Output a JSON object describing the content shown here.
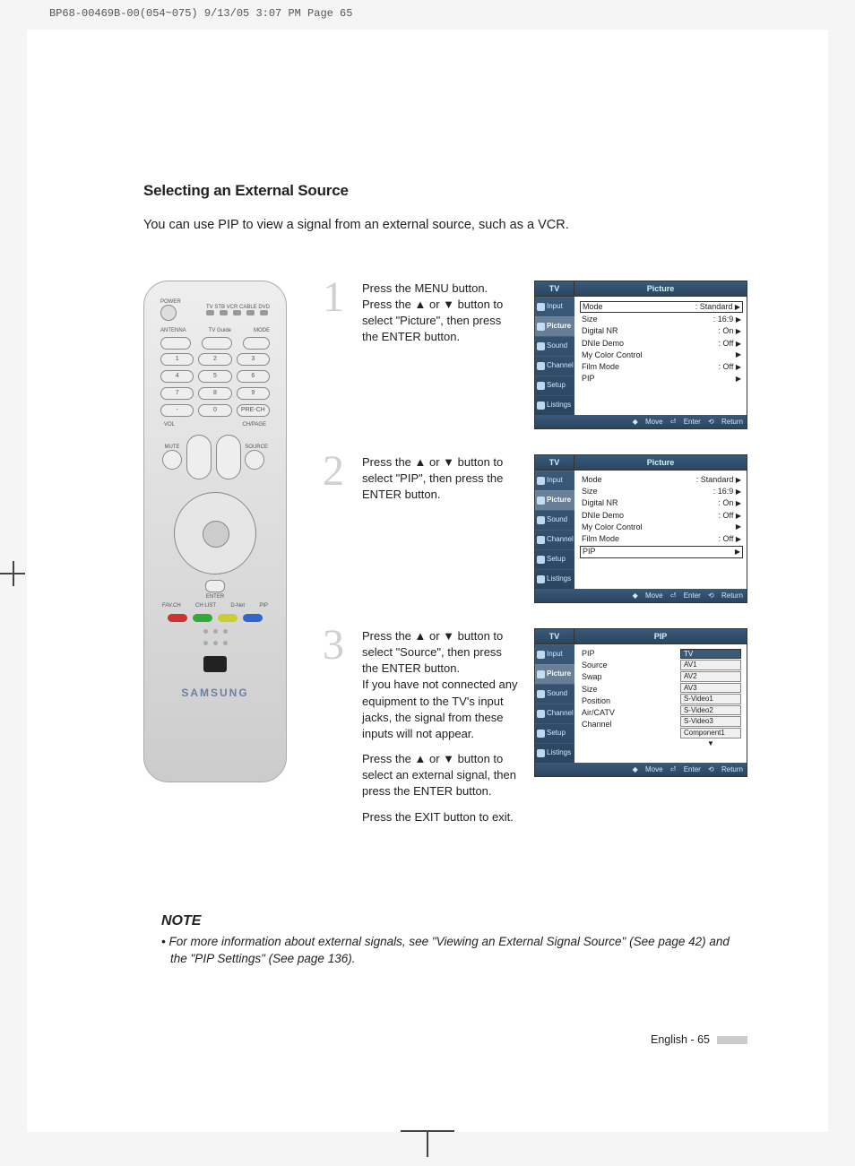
{
  "print_header": "BP68-00469B-00(054~075)  9/13/05  3:07 PM  Page 65",
  "title": "Selecting an External Source",
  "intro": "You can use PIP to view a signal from an external source, such as a VCR.",
  "remote": {
    "power": "POWER",
    "srclabels": "TV  STB  VCR  CABLE  DVD",
    "ant": "ANTENNA",
    "tvguide": "TV Guide",
    "mode": "MODE",
    "nums": [
      "1",
      "2",
      "3",
      "4",
      "5",
      "6",
      "7",
      "8",
      "9",
      "-",
      "0",
      "PRE-CH"
    ],
    "vol": "VOL",
    "mute": "MUTE",
    "chlabel": "CH/PAGE",
    "source": "SOURCE",
    "enter": "ENTER",
    "row4": [
      "FAV.CH",
      "CH LIST",
      "D-Net",
      "PIP"
    ],
    "brand": "SAMSUNG"
  },
  "steps": {
    "s1": {
      "num": "1",
      "text": "Press the MENU button.\nPress the ▲ or ▼ button to select \"Picture\", then press the ENTER button."
    },
    "s2": {
      "num": "2",
      "text": "Press the ▲ or ▼ button to select \"PIP\", then press the ENTER button."
    },
    "s3": {
      "num": "3",
      "textA": "Press the ▲ or ▼ button to select \"Source\", then press the ENTER button.\nIf you have not connected any equipment to the TV's input jacks, the signal from these inputs will not appear.",
      "textB": "Press the ▲ or ▼ button to select an external signal, then press the ENTER button.",
      "textC": "Press the EXIT button to exit."
    }
  },
  "osd": {
    "side": [
      "Input",
      "Picture",
      "Sound",
      "Channel",
      "Setup",
      "Listings"
    ],
    "footer": {
      "move": "Move",
      "enter": "Enter",
      "return": "Return"
    },
    "picture": {
      "title": "Picture",
      "tv": "TV",
      "rows": [
        {
          "k": "Mode",
          "v": ": Standard"
        },
        {
          "k": "Size",
          "v": ": 16:9"
        },
        {
          "k": "Digital NR",
          "v": ": On"
        },
        {
          "k": "DNIe Demo",
          "v": ": Off"
        },
        {
          "k": "My Color Control",
          "v": ""
        },
        {
          "k": "Film Mode",
          "v": ": Off"
        },
        {
          "k": "PIP",
          "v": ""
        }
      ]
    },
    "pip": {
      "title": "PIP",
      "tv": "TV",
      "left": [
        "PIP",
        "Source",
        "Swap",
        "Size",
        "Position",
        "Air/CATV",
        "Channel"
      ],
      "right": [
        "TV",
        "AV1",
        "AV2",
        "AV3",
        "S-Video1",
        "S-Video2",
        "S-Video3",
        "Component1"
      ]
    }
  },
  "note": {
    "title": "NOTE",
    "body": "• For more information about external signals, see \"Viewing an External Signal Source\" (See page 42) and the \"PIP Settings\" (See page 136)."
  },
  "footer": "English - 65"
}
